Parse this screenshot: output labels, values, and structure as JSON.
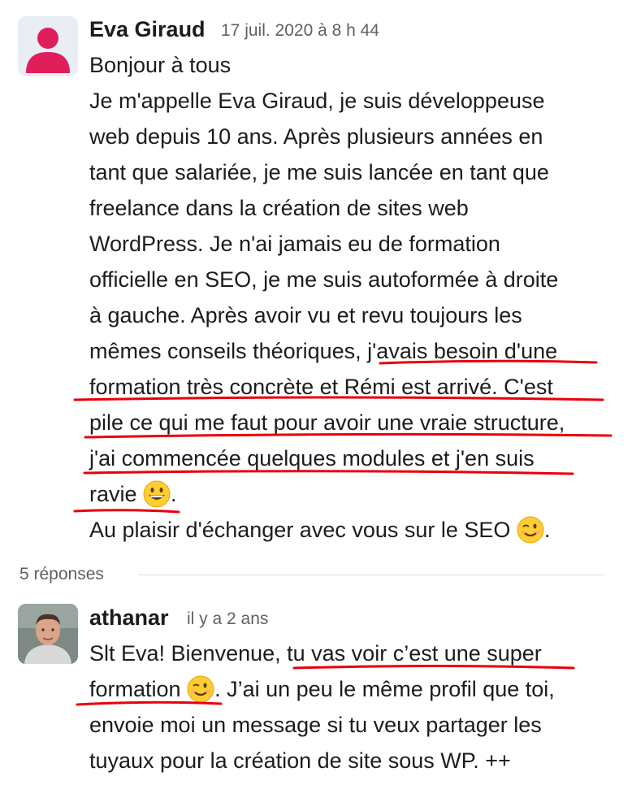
{
  "message": {
    "author": "Eva Giraud",
    "timestamp": "17 juil. 2020 à 8 h 44",
    "lines": [
      "Bonjour à tous",
      "Je m'appelle Eva Giraud, je suis développeuse",
      "web depuis 10 ans. Après plusieurs années en",
      "tant que salariée, je me suis lancée en tant que",
      "freelance dans la création de sites web",
      "WordPress. Je n'ai jamais eu de formation",
      "officielle en SEO, je me suis autoformée à droite",
      "à gauche. Après avoir vu et revu toujours les",
      "mêmes conseils théoriques, j'avais besoin d'une",
      "formation très concrète et Rémi est arrivé. C'est",
      "pile ce qui me faut pour avoir une vraie structure,",
      "j'ai commencée quelques modules et j'en suis",
      "ravie",
      "Au plaisir d'échanger avec vous sur le SEO"
    ],
    "line_end_punct": ".",
    "emoji_grin": "grinning-face",
    "emoji_wink": "winking-face"
  },
  "thread": {
    "replies_label": "5 réponses"
  },
  "reply": {
    "author": "athanar",
    "timestamp": "il y a 2 ans",
    "line1": "Slt Eva! Bienvenue, tu vas voir c’est une super",
    "line2_before": "formation",
    "line2_after": ". J’ai un peu le même profil que toi,",
    "line3": "envoie moi un message si tu veux partager les",
    "line4": "tuyaux pour la création de site sous WP. ++"
  },
  "colors": {
    "avatar_icon": "#e01e5a",
    "highlight_underline": "#e8000b",
    "emoji_yellow": "#ffcc33"
  }
}
